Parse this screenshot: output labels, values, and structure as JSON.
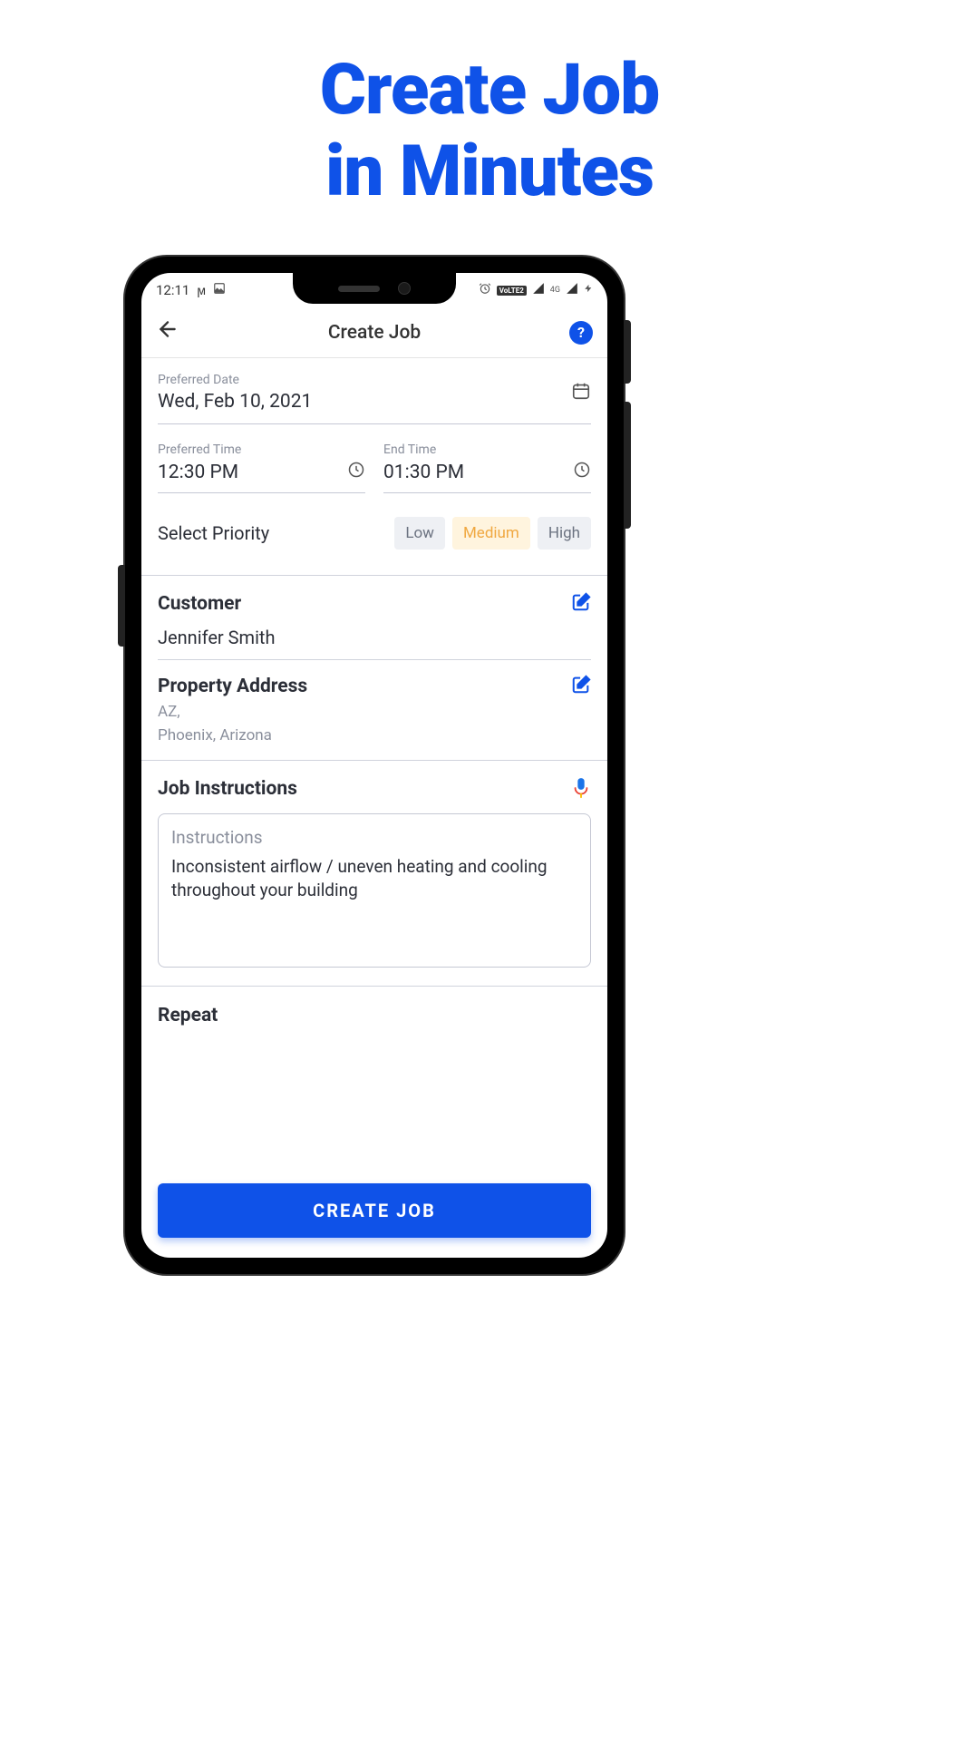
{
  "marketing": {
    "line1": "Create Job",
    "line2": "in Minutes"
  },
  "status": {
    "time": "12:11",
    "volte": "VoLTE2",
    "network": "4G"
  },
  "header": {
    "title": "Create Job"
  },
  "fields": {
    "preferred_date_label": "Preferred Date",
    "preferred_date_value": "Wed, Feb 10, 2021",
    "preferred_time_label": "Preferred Time",
    "preferred_time_value": "12:30 PM",
    "end_time_label": "End Time",
    "end_time_value": "01:30 PM"
  },
  "priority": {
    "label": "Select Priority",
    "options": {
      "low": "Low",
      "medium": "Medium",
      "high": "High"
    },
    "selected": "medium"
  },
  "customer": {
    "section_label": "Customer",
    "name": "Jennifer Smith"
  },
  "address": {
    "section_label": "Property Address",
    "line1": "AZ,",
    "line2": "Phoenix, Arizona"
  },
  "instructions": {
    "section_label": "Job Instructions",
    "placeholder": "Instructions",
    "text": "Inconsistent airflow / uneven heating and cooling throughout your building"
  },
  "repeat": {
    "label": "Repeat"
  },
  "cta": {
    "label": "CREATE JOB"
  }
}
